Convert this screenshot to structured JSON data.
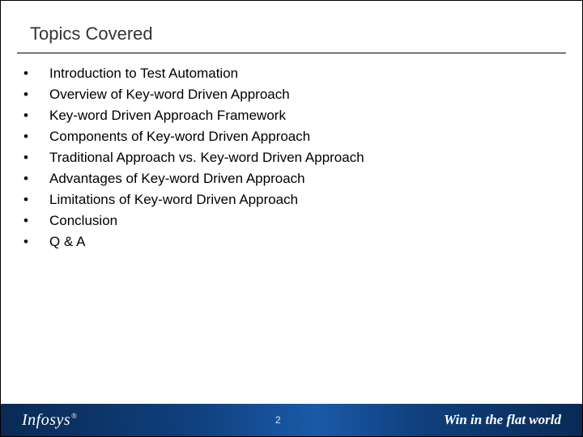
{
  "title": "Topics Covered",
  "topics": [
    "Introduction to Test Automation",
    "Overview of Key-word Driven Approach",
    "Key-word Driven Approach Framework",
    "Components of Key-word Driven Approach",
    "Traditional Approach vs. Key-word Driven Approach",
    "Advantages of Key-word Driven Approach",
    "Limitations of Key-word Driven Approach",
    "Conclusion",
    "Q & A"
  ],
  "footer": {
    "logo_text": "Infosys",
    "logo_mark": "®",
    "page_number": "2",
    "tagline": "Win in the flat world"
  }
}
